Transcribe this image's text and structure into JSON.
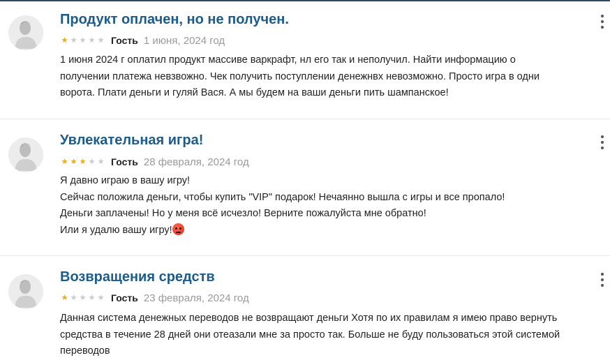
{
  "reviews": [
    {
      "title": "Продукт оплачен, но не получен.",
      "rating": 1,
      "author": "Гость",
      "date": "1 июня, 2024 год",
      "lines": [
        "1 июня 2024 г оплатил продукт массиве варкрафт, нл его так и неполучил. Найти информацию о",
        "получении платежа невзвожно. Чек получить поступлении денежнвх невозможно. Просто игра в одни",
        "ворота. Плати деньги и гуляй Вася. А мы будем на ваши деньги пить шампанское!"
      ]
    },
    {
      "title": "Увлекательная игра!",
      "rating": 3,
      "author": "Гость",
      "date": "28 февраля, 2024 год",
      "lines": [
        "Я давно играю в вашу игру!",
        "Сейчас положила деньги, чтобы купить \"VIP\" подарок! Нечаянно вышла с игры и все пропало!",
        "Деньги заплачены! Но у меня всё исчезло! Верните пожалуйста мне обратно!",
        "Или я удалю вашу игру!"
      ],
      "trailing_emoji": "angry-face-icon"
    },
    {
      "title": "Возвращения средств",
      "rating": 1,
      "author": "Гость",
      "date": "23 февраля, 2024 год",
      "lines": [
        "Данная система денежных переводов не возвращают деньги Хотя по их правилам я имею право вернуть",
        "средства в течение 28 дней они отеазали мне за просто так. Больше не буду пользоваться этой системой",
        "переводов"
      ]
    }
  ],
  "max_rating": 5,
  "colors": {
    "title": "#1b5c8c",
    "star_on": "#f0a81a",
    "star_off": "#c9c9c9",
    "date": "#9a9a9a",
    "top_rule": "#2f4a66"
  }
}
